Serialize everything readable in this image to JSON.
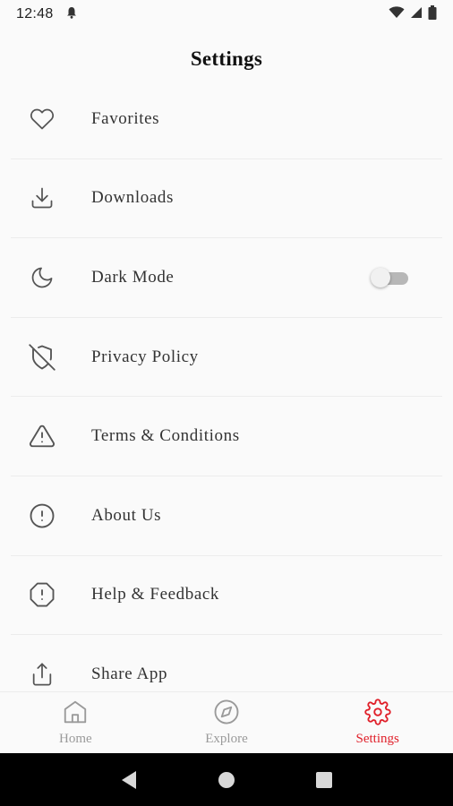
{
  "status_bar": {
    "time": "12:48",
    "icons": [
      "notification-bell-icon",
      "wifi-icon",
      "signal-icon",
      "battery-icon"
    ]
  },
  "header": {
    "title": "Settings"
  },
  "settings_items": [
    {
      "label": "Favorites",
      "icon": "heart-icon"
    },
    {
      "label": "Downloads",
      "icon": "download-icon"
    },
    {
      "label": "Dark Mode",
      "icon": "moon-icon",
      "toggle": false
    },
    {
      "label": "Privacy Policy",
      "icon": "shield-off-icon"
    },
    {
      "label": "Terms & Conditions",
      "icon": "alert-triangle-icon"
    },
    {
      "label": "About Us",
      "icon": "alert-circle-icon"
    },
    {
      "label": "Help & Feedback",
      "icon": "alert-octagon-icon"
    },
    {
      "label": "Share App",
      "icon": "share-icon"
    }
  ],
  "bottom_nav": {
    "items": [
      {
        "label": "Home",
        "icon": "home-icon",
        "active": false
      },
      {
        "label": "Explore",
        "icon": "compass-icon",
        "active": false
      },
      {
        "label": "Settings",
        "icon": "gear-icon",
        "active": true
      }
    ]
  },
  "colors": {
    "accent": "#e0202a",
    "inactive": "#9a9a9a",
    "icon": "#555555",
    "background": "#fafafa"
  }
}
